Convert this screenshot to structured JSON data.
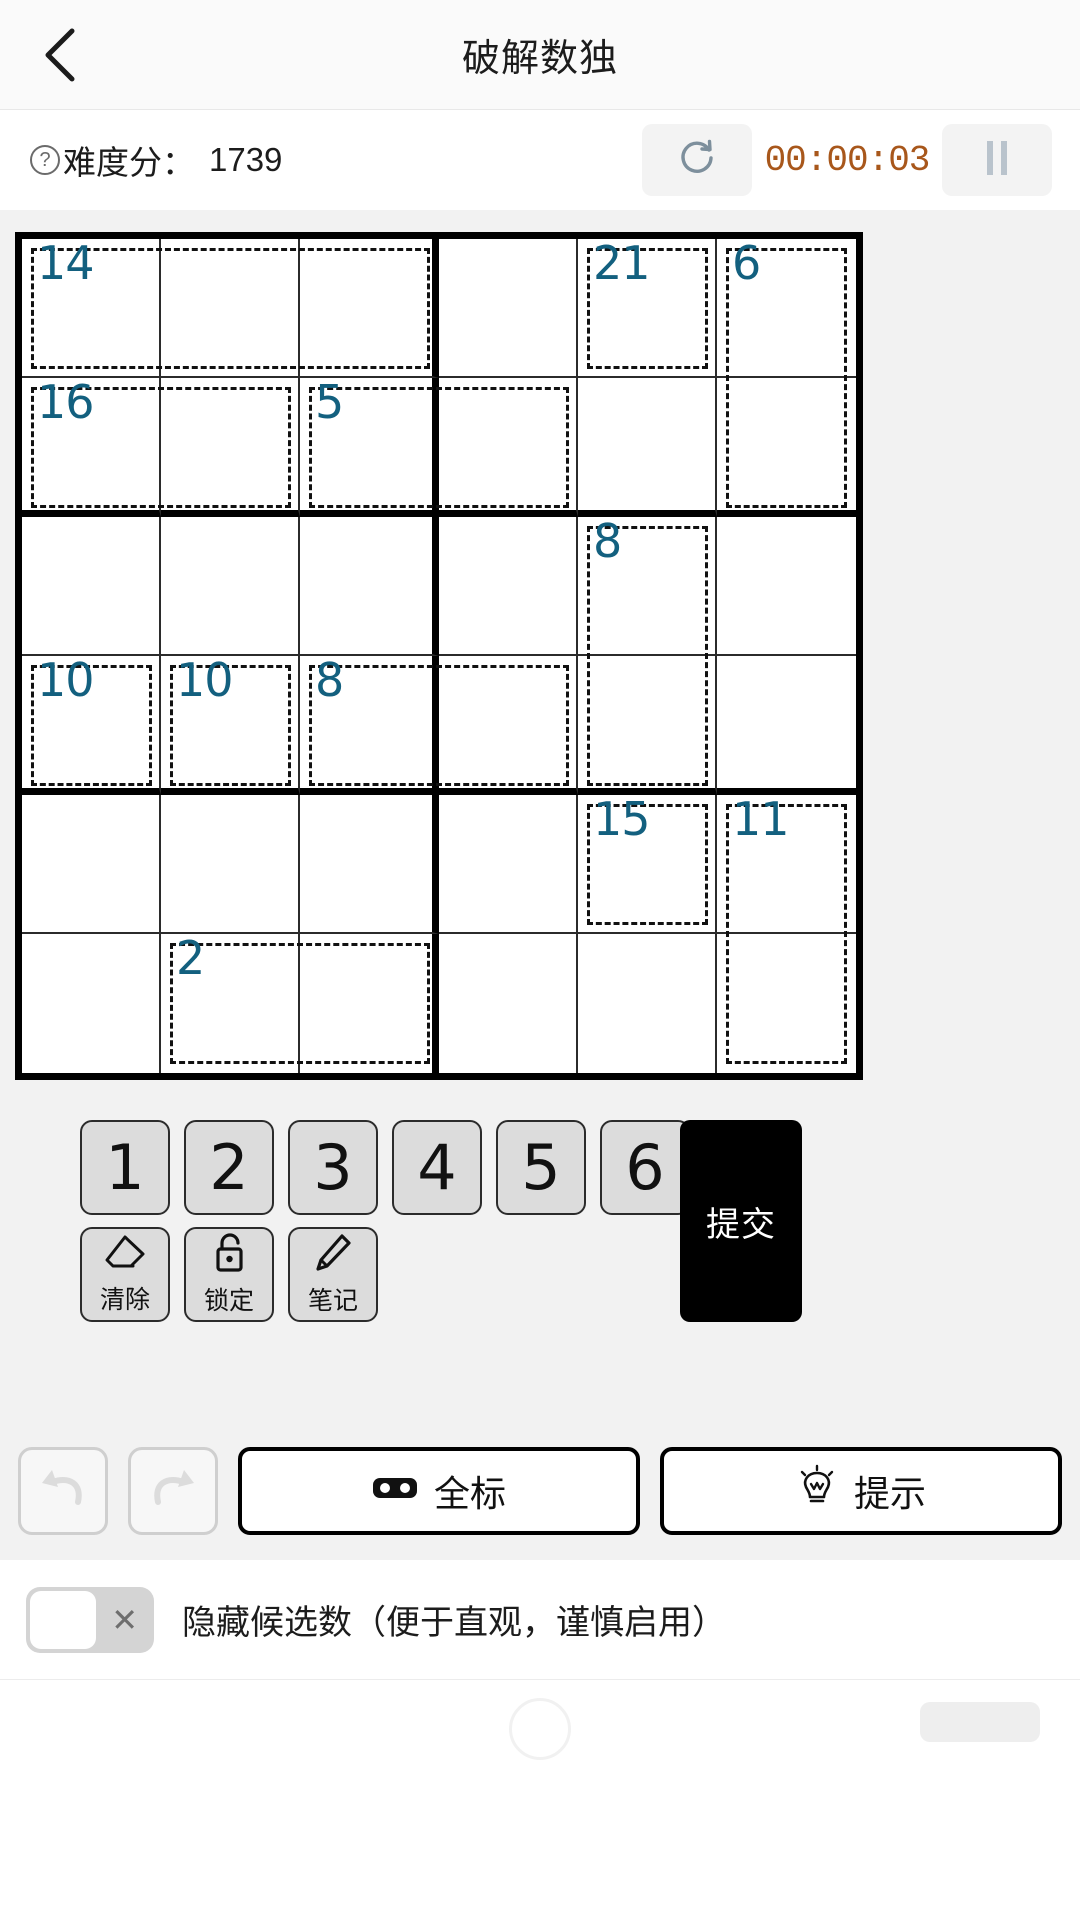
{
  "nav": {
    "back_icon": "chevron-left-icon",
    "title": "破解数独"
  },
  "stats": {
    "help_icon": "question-circle-icon",
    "difficulty_label": "难度分：",
    "difficulty_value": "1739",
    "refresh_icon": "refresh-icon",
    "timer": "00:00:03",
    "pause_icon": "pause-icon",
    "timer_color": "#a8571b"
  },
  "board": {
    "size": 6,
    "cages": [
      {
        "sum": "14",
        "r": 1,
        "c": 1,
        "rs": 1,
        "cs": 3
      },
      {
        "sum": "21",
        "r": 1,
        "c": 5,
        "rs": 1,
        "cs": 1
      },
      {
        "sum": "6",
        "r": 1,
        "c": 6,
        "rs": 2,
        "cs": 1
      },
      {
        "sum": "16",
        "r": 2,
        "c": 1,
        "rs": 1,
        "cs": 2
      },
      {
        "sum": "5",
        "r": 2,
        "c": 3,
        "rs": 1,
        "cs": 2
      },
      {
        "sum": "8",
        "r": 3,
        "c": 5,
        "rs": 2,
        "cs": 1
      },
      {
        "sum": "10",
        "r": 4,
        "c": 1,
        "rs": 1,
        "cs": 1
      },
      {
        "sum": "10",
        "r": 4,
        "c": 2,
        "rs": 1,
        "cs": 1
      },
      {
        "sum": "8",
        "r": 4,
        "c": 3,
        "rs": 1,
        "cs": 2
      },
      {
        "sum": "15",
        "r": 5,
        "c": 5,
        "rs": 1,
        "cs": 1
      },
      {
        "sum": "11",
        "r": 5,
        "c": 6,
        "rs": 2,
        "cs": 1
      },
      {
        "sum": "2",
        "r": 6,
        "c": 2,
        "rs": 1,
        "cs": 2
      }
    ],
    "values": []
  },
  "pad": {
    "numbers": [
      "1",
      "2",
      "3",
      "4",
      "5",
      "6"
    ],
    "tools": [
      {
        "label": "清除",
        "icon": "eraser-icon"
      },
      {
        "label": "锁定",
        "icon": "unlock-icon"
      },
      {
        "label": "笔记",
        "icon": "pencil-icon"
      }
    ],
    "submit_label": "提交"
  },
  "actions": {
    "undo_icon": "undo-arrow-icon",
    "redo_icon": "redo-arrow-icon",
    "mark_all": {
      "label": "全标",
      "icon": "glasses-icon"
    },
    "hint": {
      "label": "提示",
      "icon": "lightbulb-icon"
    }
  },
  "toggle": {
    "state_icon": "x-icon",
    "state": "off",
    "label": "隐藏候选数（便于直观，谨慎启用）"
  }
}
